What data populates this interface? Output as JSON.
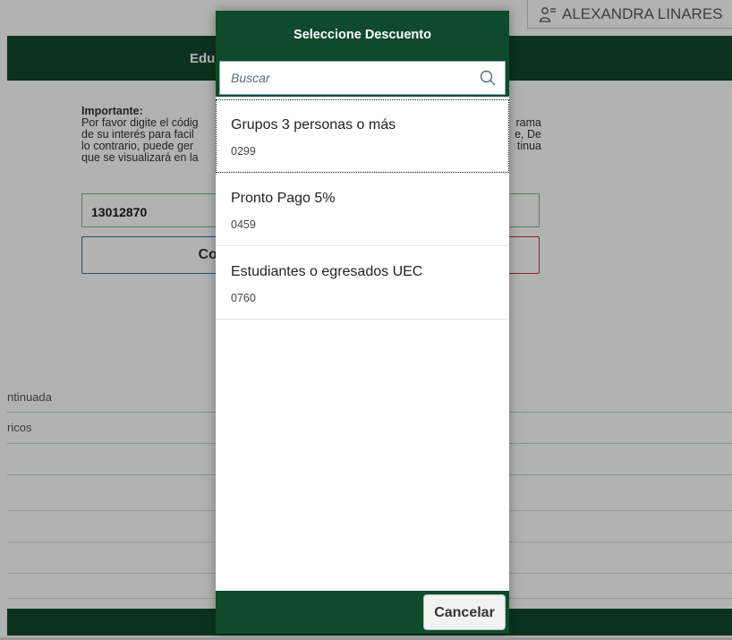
{
  "background": {
    "user": {
      "name": "ALEXANDRA LINARES",
      "icon": "user-list-icon"
    },
    "band_title": "Edu",
    "notice": {
      "heading": "Importante:",
      "line1_left": "Por favor digite el códig",
      "line1_right": "rama",
      "line2_left": "de su interés para facil",
      "line2_right": "e, De",
      "line3_left": "lo contrario, puede ger",
      "line3_right": "tinua",
      "line4_left": "que se visualizará en la"
    },
    "code_value": "13012870",
    "consult_label": "Cons",
    "rows": [
      "ntinuada",
      "ricos"
    ]
  },
  "dialog": {
    "title": "Seleccione Descuento",
    "search": {
      "placeholder": "Buscar",
      "icon": "search-icon"
    },
    "items": [
      {
        "name": "Grupos 3 personas o más",
        "code": "0299"
      },
      {
        "name": "Pronto Pago 5%",
        "code": "0459"
      },
      {
        "name": "Estudiantes o egresados UEC",
        "code": "0760"
      }
    ],
    "cancel_label": "Cancelar"
  },
  "colors": {
    "brand_green": "#0f4a2c",
    "overlay": "rgba(0,0,0,0.30)"
  }
}
